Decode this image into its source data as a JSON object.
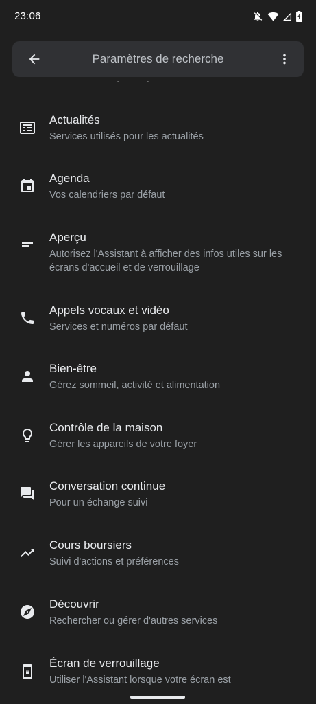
{
  "status_bar": {
    "time": "23:06",
    "icons": [
      "notifications-off-icon",
      "wifi-icon",
      "cell-signal-icon",
      "battery-charging-icon"
    ]
  },
  "search_bar": {
    "title": "Paramètres de recherche",
    "back_icon": "arrow-back-icon",
    "more_icon": "more-vert-icon"
  },
  "settings": [
    {
      "title": "Actualités",
      "subtitle": "Services utilisés pour les actualités",
      "icon": "newspaper-icon"
    },
    {
      "title": "Agenda",
      "subtitle": "Vos calendriers par défaut",
      "icon": "calendar-icon"
    },
    {
      "title": "Aperçu",
      "subtitle": "Autorisez l'Assistant à afficher des infos utiles sur les écrans d'accueil et de verrouillage",
      "icon": "short-text-icon"
    },
    {
      "title": "Appels vocaux et vidéo",
      "subtitle": "Services et numéros par défaut",
      "icon": "phone-icon"
    },
    {
      "title": "Bien-être",
      "subtitle": "Gérez sommeil, activité et alimentation",
      "icon": "person-icon"
    },
    {
      "title": "Contrôle de la maison",
      "subtitle": "Gérer les appareils de votre foyer",
      "icon": "lightbulb-icon"
    },
    {
      "title": "Conversation continue",
      "subtitle": "Pour un échange suivi",
      "icon": "forum-icon"
    },
    {
      "title": "Cours boursiers",
      "subtitle": "Suivi d'actions et préférences",
      "icon": "trending-up-icon"
    },
    {
      "title": "Découvrir",
      "subtitle": "Rechercher ou gérer d'autres services",
      "icon": "explore-icon"
    },
    {
      "title": "Écran de verrouillage",
      "subtitle": "Utiliser l'Assistant lorsque votre écran est",
      "icon": "phone-lock-icon"
    }
  ]
}
